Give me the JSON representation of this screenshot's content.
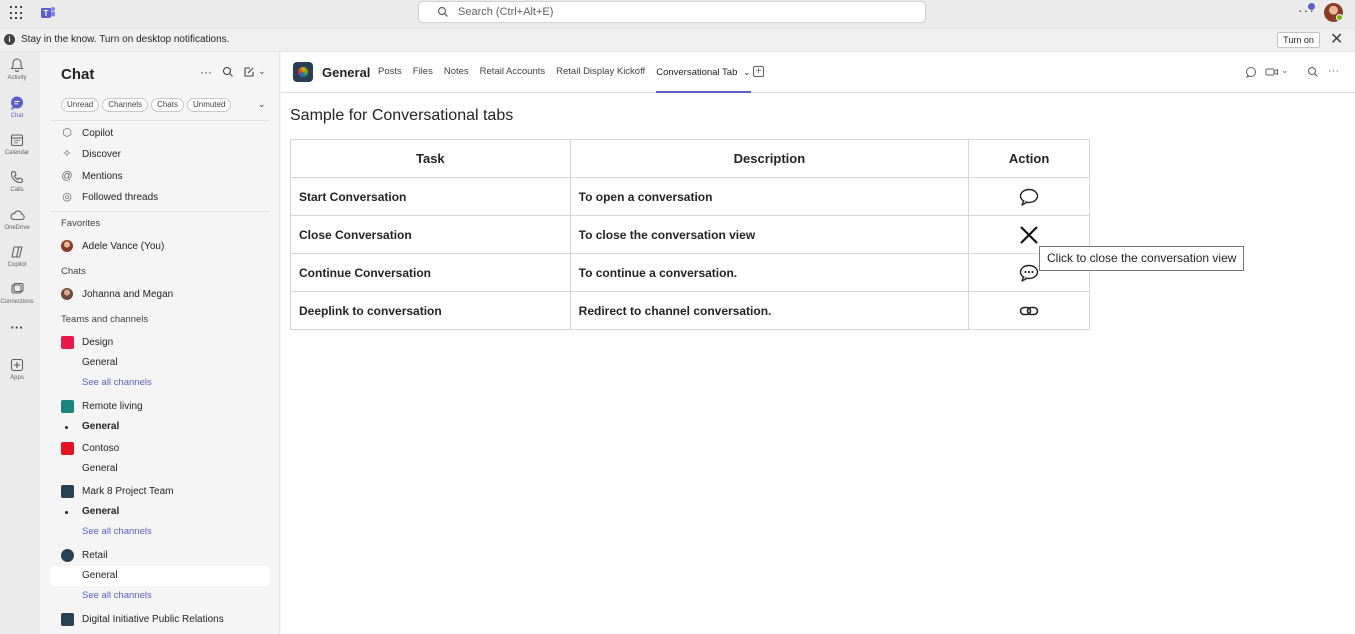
{
  "titlebar": {
    "search_placeholder": "Search (Ctrl+Alt+E)",
    "more_icon": "ellipsis-icon",
    "accent": "#5b5fc7"
  },
  "notification": {
    "message": "Stay in the know. Turn on desktop notifications.",
    "turn_on_label": "Turn on"
  },
  "rail": {
    "items": [
      {
        "label": "Activity",
        "icon": "bell-icon"
      },
      {
        "label": "Chat",
        "icon": "chat-icon"
      },
      {
        "label": "Calendar",
        "icon": "calendar-icon"
      },
      {
        "label": "Calls",
        "icon": "phone-icon"
      },
      {
        "label": "OneDrive",
        "icon": "cloud-icon"
      },
      {
        "label": "Copilot",
        "icon": "copilot-icon"
      },
      {
        "label": "Connections",
        "icon": "connections-icon"
      },
      {
        "label": "Apps",
        "icon": "apps-icon"
      }
    ],
    "more_label": "···"
  },
  "chatpane": {
    "title": "Chat",
    "filters": [
      "Unread",
      "Channels",
      "Chats",
      "Unmuted"
    ],
    "nav": [
      {
        "label": "Copilot",
        "icon": "copilot-icon"
      },
      {
        "label": "Discover",
        "icon": "discover-icon"
      },
      {
        "label": "Mentions",
        "icon": "at-icon"
      },
      {
        "label": "Followed threads",
        "icon": "followed-icon"
      }
    ],
    "favorites_label": "Favorites",
    "favorites": [
      {
        "label": "Adele Vance (You)"
      }
    ],
    "chats_label": "Chats",
    "chats": [
      {
        "label": "Johanna and Megan"
      }
    ],
    "teams_label": "Teams and channels",
    "teams": [
      {
        "name": "Design",
        "color": "#e8194a",
        "channels": [
          {
            "label": "General",
            "bold": false
          }
        ],
        "see_all": "See all channels"
      },
      {
        "name": "Remote living",
        "color": "#1b8380",
        "channels": [
          {
            "label": "General",
            "bold": true
          }
        ],
        "see_all": ""
      },
      {
        "name": "Contoso",
        "color": "#e81123",
        "channels": [
          {
            "label": "General",
            "bold": false
          }
        ],
        "see_all": ""
      },
      {
        "name": "Mark 8 Project Team",
        "color": "#2b3f52",
        "channels": [
          {
            "label": "General",
            "bold": true
          }
        ],
        "see_all": "See all channels"
      },
      {
        "name": "Retail",
        "color": "#2b3f52",
        "channels": [
          {
            "label": "General",
            "bold": false
          }
        ],
        "see_all": "See all channels"
      },
      {
        "name": "Digital Initiative Public Relations",
        "color": "#2b3f52",
        "channels": [],
        "see_all": ""
      }
    ]
  },
  "channel_header": {
    "name": "General",
    "tabs": [
      "Posts",
      "Files",
      "Notes",
      "Retail Accounts",
      "Retail Display Kickoff",
      "Conversational Tab"
    ],
    "active_tab": "Conversational Tab"
  },
  "content": {
    "title": "Sample for Conversational tabs",
    "columns": [
      "Task",
      "Description",
      "Action"
    ],
    "rows": [
      {
        "task": "Start Conversation",
        "description": "To open a conversation",
        "action_icon": "chat-bubble-icon"
      },
      {
        "task": "Close Conversation",
        "description": "To close the conversation view",
        "action_icon": "close-x-icon"
      },
      {
        "task": "Continue Conversation",
        "description": "To continue a conversation.",
        "action_icon": "chat-dots-icon"
      },
      {
        "task": "Deeplink to conversation",
        "description": "Redirect to channel conversation.",
        "action_icon": "link-icon"
      }
    ],
    "tooltip": "Click to close the conversation view"
  }
}
